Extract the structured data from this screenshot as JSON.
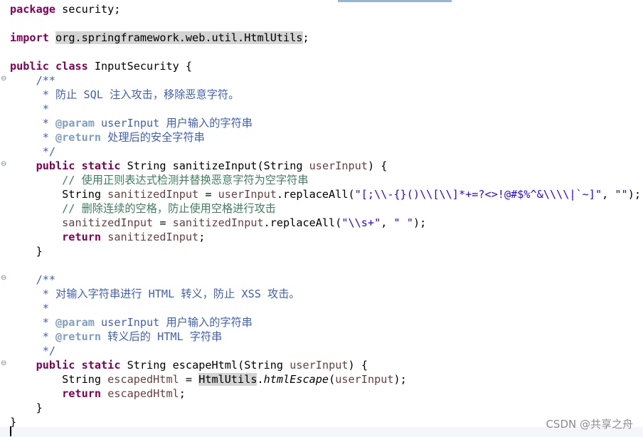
{
  "editor": {
    "code": {
      "l1_kw": "package",
      "l1_rest": " security;",
      "l3_kw": "import",
      "l3_pkg": "org.springframework.web.util.HtmlUtils",
      "l3_end": ";",
      "l5_kw1": "public",
      "l5_kw2": "class",
      "l5_rest": " InputSecurity {",
      "l6": "    /**",
      "l7": "     * 防止 SQL 注入攻击，移除恶意字符。",
      "l8": "     *",
      "l9_pre": "     * ",
      "l9_tag": "@param",
      "l9_rest": " userInput 用户输入的字符串",
      "l10_pre": "     * ",
      "l10_tag": "@return",
      "l10_rest": " 处理后的安全字符串",
      "l11": "     */",
      "l12_kw1": "public",
      "l12_kw2": "static",
      "l12_mid": " String sanitizeInput(String ",
      "l12_var": "userInput",
      "l12_end": ") {",
      "l13": "        // 使用正则表达式检测并替换恶意字符为空字符串",
      "l14_pre": "        String ",
      "l14_var1": "sanitizedInput",
      "l14_eq": " = ",
      "l14_var2": "userInput",
      "l14_call": ".replaceAll(",
      "l14_str1": "\"[;\\\\-{}()\\\\[\\\\]*+=?<>!@#$%^&\\\\\\\\|`~]\"",
      "l14_comma": ", ",
      "l14_str2": "\"\"",
      "l14_end": ");",
      "l15": "        // 删除连续的空格，防止使用空格进行攻击",
      "l16_var1": "sanitizedInput",
      "l16_eq": " = ",
      "l16_var2": "sanitizedInput",
      "l16_call": ".replaceAll(",
      "l16_str1": "\"\\\\s+\"",
      "l16_comma": ", ",
      "l16_str2": "\" \"",
      "l16_end": ");",
      "l17_kw": "return",
      "l17_var": "sanitizedInput",
      "l17_end": ";",
      "l18": "    }",
      "l20": "    /**",
      "l21": "     * 对输入字符串进行 HTML 转义，防止 XSS 攻击。",
      "l22": "     *",
      "l23_pre": "     * ",
      "l23_tag": "@param",
      "l23_rest": " userInput 用户输入的字符串",
      "l24_pre": "     * ",
      "l24_tag": "@return",
      "l24_rest": " 转义后的 HTML 字符串",
      "l25": "     */",
      "l26_kw1": "public",
      "l26_kw2": "static",
      "l26_mid": " String escapeHtml(String ",
      "l26_var": "userInput",
      "l26_end": ") {",
      "l27_pre": "        String ",
      "l27_var": "escapedHtml",
      "l27_eq": " = ",
      "l27_cls": "HtmlUtils",
      "l27_dot": ".",
      "l27_mth": "htmlEscape",
      "l27_open": "(",
      "l27_arg": "userInput",
      "l27_end": ");",
      "l28_kw": "return",
      "l28_var": "escapedHtml",
      "l28_end": ";",
      "l29": "    }",
      "l30": "}"
    }
  },
  "watermark": "CSDN @共享之舟",
  "colors": {
    "keyword": "#7f0055",
    "javadoc": "#3f5fbf",
    "javadoc_tag": "#7f9fbf",
    "comment": "#3f7f5f",
    "string": "#2a00ff",
    "local_var": "#6a3e3e"
  }
}
